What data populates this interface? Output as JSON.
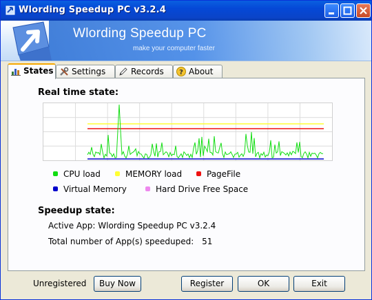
{
  "window": {
    "title": "Wlording Speedup PC v3.2.4"
  },
  "banner": {
    "title": "Wlording Speedup PC",
    "subtitle": "make your computer faster"
  },
  "tabs": [
    {
      "label": "States",
      "icon": "chart-icon",
      "active": true
    },
    {
      "label": "Settings",
      "icon": "tools-icon"
    },
    {
      "label": "Records",
      "icon": "pencil-icon"
    },
    {
      "label": "About",
      "icon": "help-icon"
    }
  ],
  "realtime": {
    "title": "Real time state:"
  },
  "legend": [
    {
      "label": "CPU load",
      "color": "#11dd11"
    },
    {
      "label": "MEMORY load",
      "color": "#ffff33"
    },
    {
      "label": "PageFile",
      "color": "#ee1111"
    },
    {
      "label": "Virtual Memory",
      "color": "#0000cc"
    },
    {
      "label": "Hard Drive Free Space",
      "color": "#ee88ee"
    }
  ],
  "speedup": {
    "title": "Speedup state:",
    "active_app_label": "Active App:",
    "active_app_value": "Wlording Speedup PC v3.2.4",
    "count_label": "Total number of App(s) speeduped:",
    "count_value": "51"
  },
  "footer": {
    "status": "Unregistered",
    "buy_now": "Buy Now",
    "register": "Register",
    "ok": "OK",
    "exit": "Exit"
  }
}
